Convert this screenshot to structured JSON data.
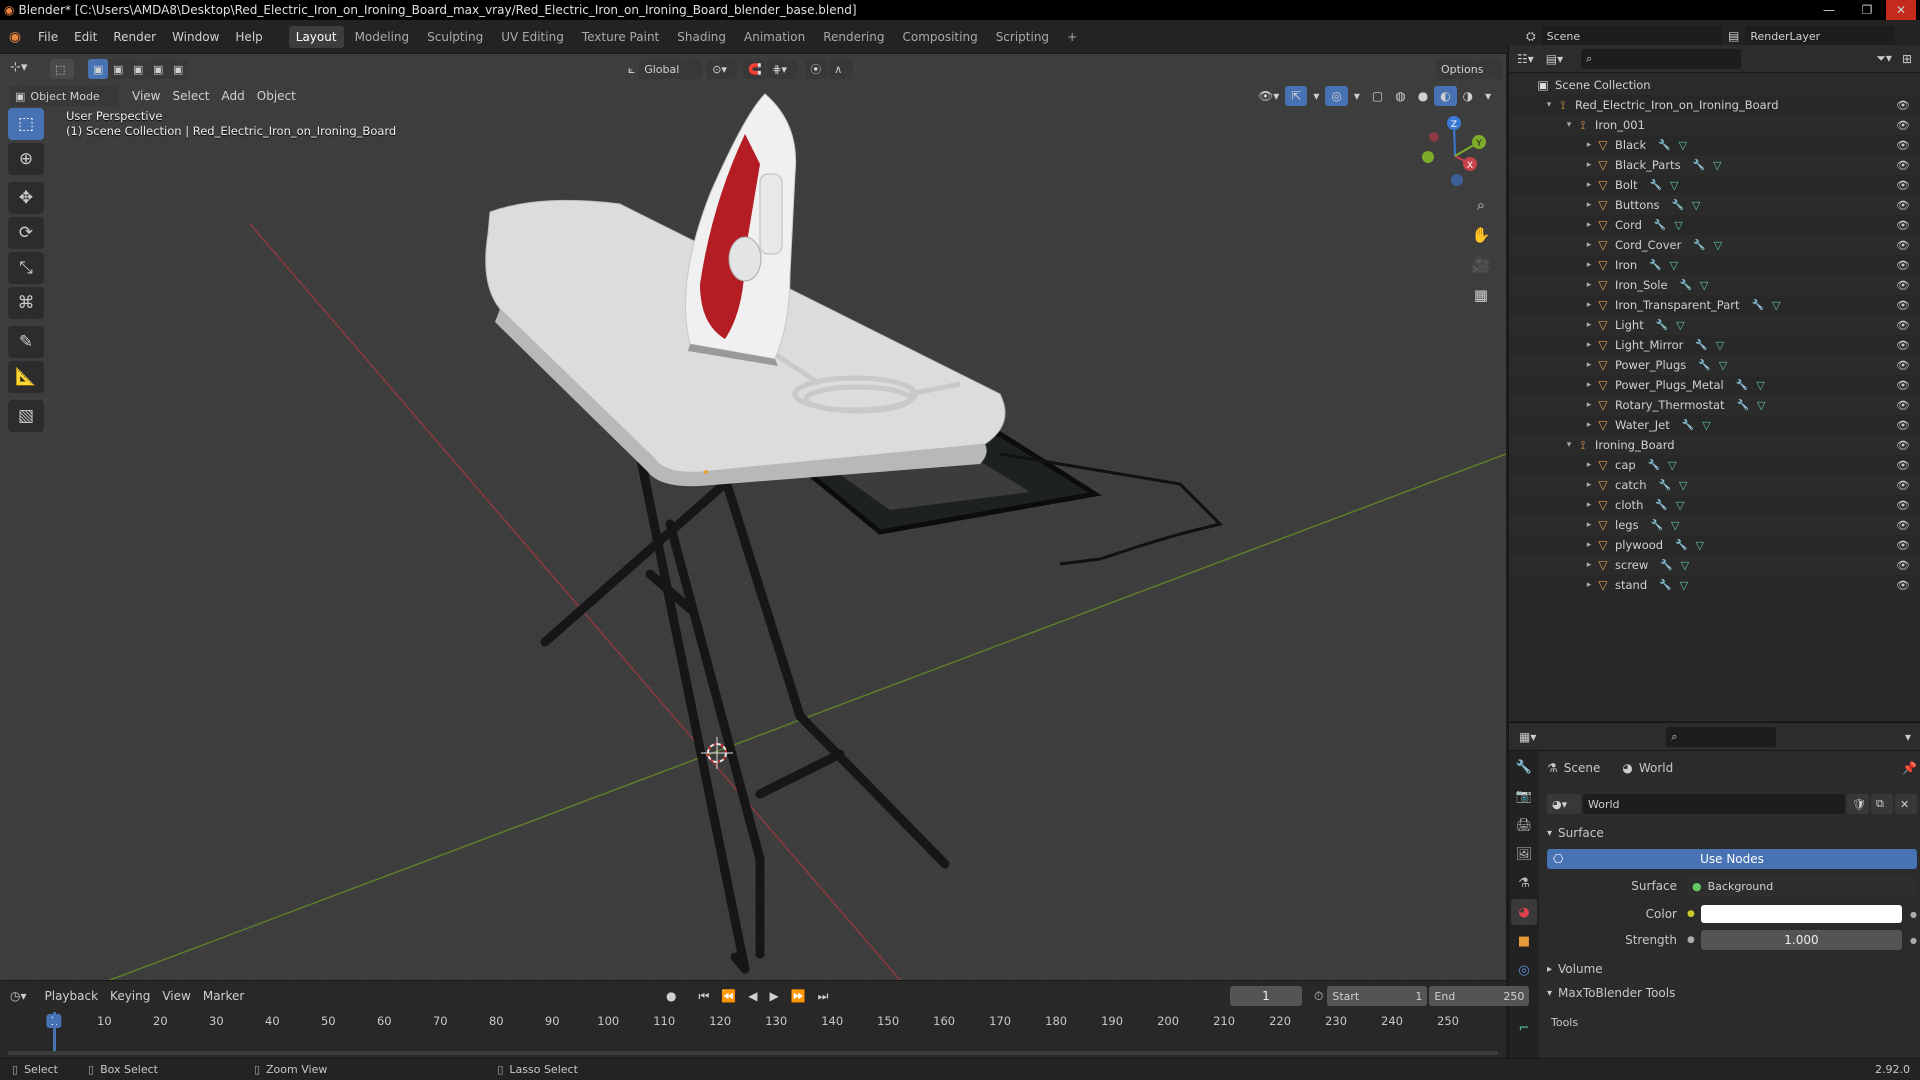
{
  "window": {
    "title": "Blender* [C:\\Users\\AMDA8\\Desktop\\Red_Electric_Iron_on_Ironing_Board_max_vray/Red_Electric_Iron_on_Ironing_Board_blender_base.blend]",
    "minimize": "—",
    "maximize": "❐",
    "close": "✕"
  },
  "menu": [
    "File",
    "Edit",
    "Render",
    "Window",
    "Help"
  ],
  "workspaces": [
    "Layout",
    "Modeling",
    "Sculpting",
    "UV Editing",
    "Texture Paint",
    "Shading",
    "Animation",
    "Rendering",
    "Compositing",
    "Scripting",
    "+"
  ],
  "active_workspace": "Layout",
  "scene": {
    "label": "Scene",
    "render_layer": "RenderLayer"
  },
  "viewport": {
    "mode": "Object Mode",
    "menus": [
      "View",
      "Select",
      "Add",
      "Object"
    ],
    "transform_orientation": "Global",
    "options": "Options",
    "perspective": "User Perspective",
    "collection_info": "(1) Scene Collection | Red_Electric_Iron_on_Ironing_Board",
    "gizmo_x": "X",
    "gizmo_y": "Y",
    "gizmo_z": "Z"
  },
  "outliner": {
    "rows": [
      {
        "label": "Scene Collection",
        "depth": 0,
        "icon": "collection",
        "exp": ""
      },
      {
        "label": "Red_Electric_Iron_on_Ironing_Board",
        "depth": 1,
        "icon": "empty",
        "exp": "▾"
      },
      {
        "label": "Iron_001",
        "depth": 2,
        "icon": "empty",
        "exp": "▾"
      },
      {
        "label": "Black",
        "depth": 3,
        "icon": "mesh",
        "exp": "▸"
      },
      {
        "label": "Black_Parts",
        "depth": 3,
        "icon": "mesh",
        "exp": "▸"
      },
      {
        "label": "Bolt",
        "depth": 3,
        "icon": "mesh",
        "exp": "▸"
      },
      {
        "label": "Buttons",
        "depth": 3,
        "icon": "mesh",
        "exp": "▸"
      },
      {
        "label": "Cord",
        "depth": 3,
        "icon": "mesh",
        "exp": "▸"
      },
      {
        "label": "Cord_Cover",
        "depth": 3,
        "icon": "mesh",
        "exp": "▸"
      },
      {
        "label": "Iron",
        "depth": 3,
        "icon": "mesh",
        "exp": "▸"
      },
      {
        "label": "Iron_Sole",
        "depth": 3,
        "icon": "mesh",
        "exp": "▸"
      },
      {
        "label": "Iron_Transparent_Part",
        "depth": 3,
        "icon": "mesh",
        "exp": "▸"
      },
      {
        "label": "Light",
        "depth": 3,
        "icon": "mesh",
        "exp": "▸"
      },
      {
        "label": "Light_Mirror",
        "depth": 3,
        "icon": "mesh",
        "exp": "▸"
      },
      {
        "label": "Power_Plugs",
        "depth": 3,
        "icon": "mesh",
        "exp": "▸"
      },
      {
        "label": "Power_Plugs_Metal",
        "depth": 3,
        "icon": "mesh",
        "exp": "▸"
      },
      {
        "label": "Rotary_Thermostat",
        "depth": 3,
        "icon": "mesh",
        "exp": "▸"
      },
      {
        "label": "Water_Jet",
        "depth": 3,
        "icon": "mesh",
        "exp": "▸"
      },
      {
        "label": "Ironing_Board",
        "depth": 2,
        "icon": "empty",
        "exp": "▾"
      },
      {
        "label": "cap",
        "depth": 3,
        "icon": "mesh",
        "exp": "▸"
      },
      {
        "label": "catch",
        "depth": 3,
        "icon": "mesh",
        "exp": "▸"
      },
      {
        "label": "cloth",
        "depth": 3,
        "icon": "mesh",
        "exp": "▸"
      },
      {
        "label": "legs",
        "depth": 3,
        "icon": "mesh",
        "exp": "▸"
      },
      {
        "label": "plywood",
        "depth": 3,
        "icon": "mesh",
        "exp": "▸"
      },
      {
        "label": "screw",
        "depth": 3,
        "icon": "mesh",
        "exp": "▸"
      },
      {
        "label": "stand",
        "depth": 3,
        "icon": "mesh",
        "exp": "▸"
      }
    ]
  },
  "properties": {
    "crumb_scene": "Scene",
    "crumb_world": "World",
    "world_name": "World",
    "surface_panel": "Surface",
    "use_nodes": "Use Nodes",
    "surface_label": "Surface",
    "surface_value": "Background",
    "color_label": "Color",
    "strength_label": "Strength",
    "strength_value": "1.000",
    "volume_panel": "Volume",
    "maxtoblender_panel": "MaxToBlender Tools",
    "tools_label": "Tools"
  },
  "timeline": {
    "menus": [
      "Playback",
      "Keying",
      "View",
      "Marker"
    ],
    "current_frame": "1",
    "start_label": "Start",
    "start": "1",
    "end_label": "End",
    "end": "250",
    "ticks": [
      "1",
      "10",
      "20",
      "30",
      "40",
      "50",
      "60",
      "70",
      "80",
      "90",
      "100",
      "110",
      "120",
      "130",
      "140",
      "150",
      "160",
      "170",
      "180",
      "190",
      "200",
      "210",
      "220",
      "230",
      "240",
      "250"
    ]
  },
  "statusbar": {
    "select": "Select",
    "box_select": "Box Select",
    "zoom_view": "Zoom View",
    "lasso_select": "Lasso Select",
    "version": "2.92.0"
  },
  "colors": {
    "accent": "#4772b3",
    "x_axis": "#c8424c",
    "y_axis": "#7cac2a",
    "z_axis": "#3a7ad4"
  }
}
